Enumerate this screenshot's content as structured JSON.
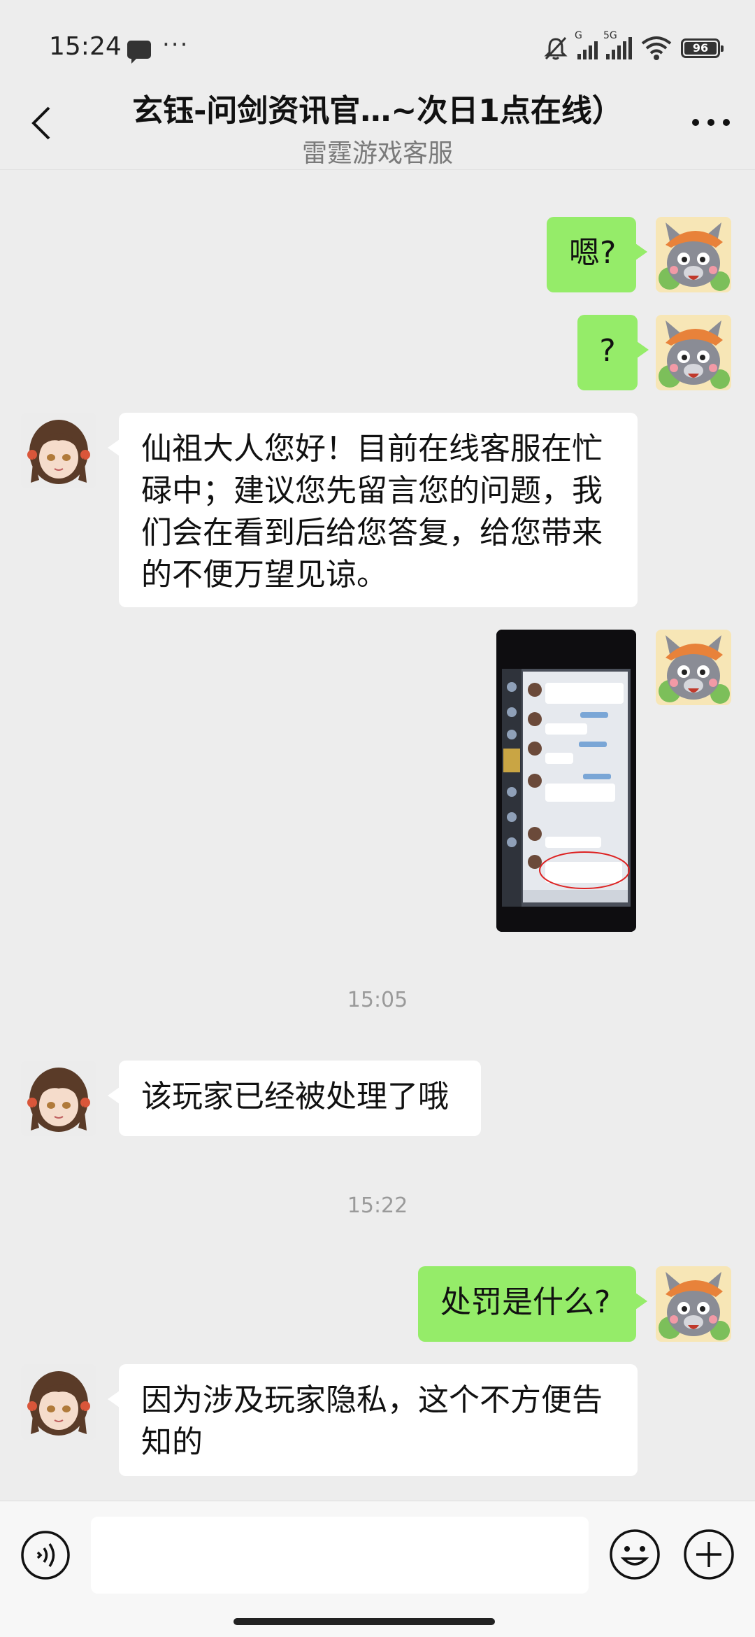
{
  "status_bar": {
    "time": "15:24",
    "more": "···",
    "signal1_label": "G",
    "signal2_label": "5G",
    "battery": "96"
  },
  "header": {
    "title": "玄钰-问剑资讯官…~次日1点在线）",
    "subtitle": "雷霆游戏客服"
  },
  "messages": [
    {
      "from": "me",
      "text": "嗯?"
    },
    {
      "from": "me",
      "text": "?"
    },
    {
      "from": "cs",
      "lines": [
        "仙祖大人您好！目前在线客服在忙",
        "碌中；建议您先留言您的问题，我",
        "们会在看到后给您答复，给您带来",
        "的不便万望见谅。"
      ]
    },
    {
      "from": "me",
      "type": "image"
    },
    {
      "timestamp": "15:05"
    },
    {
      "from": "cs",
      "text": "该玩家已经被处理了哦"
    },
    {
      "timestamp": "15:22"
    },
    {
      "from": "me",
      "text": "处罚是什么?"
    },
    {
      "from": "cs",
      "lines": [
        "因为涉及玩家隐私，这个不方便告",
        "知的"
      ]
    }
  ],
  "input": {
    "placeholder": ""
  },
  "icons": {
    "back": "chevron-left-icon",
    "more": "more-icon",
    "voice": "voice-icon",
    "emoji": "emoji-icon",
    "plus": "plus-icon"
  },
  "colors": {
    "background": "#ededed",
    "my_bubble": "#95ec69",
    "their_bubble": "#ffffff"
  }
}
